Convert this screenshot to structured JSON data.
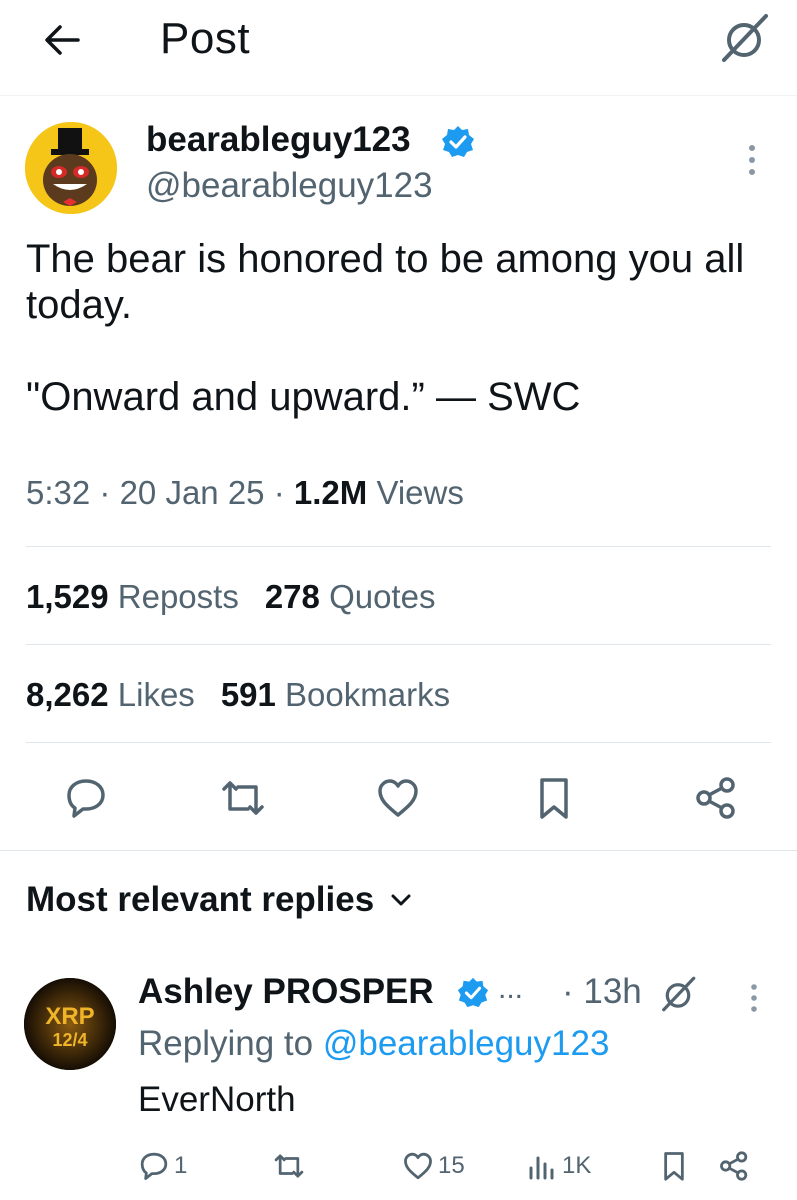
{
  "header": {
    "title": "Post"
  },
  "post": {
    "display_name": "bearableguy123",
    "handle": "@bearableguy123",
    "text": "The bear is honored to be among you all today.\n\n\"Onward and upward.” — SWC",
    "time": "5:32",
    "date": "20 Jan 25",
    "views_count": "1.2M",
    "views_label": "Views",
    "separator": "·"
  },
  "stats": {
    "reposts_count": "1,529",
    "reposts_label": "Reposts",
    "quotes_count": "278",
    "quotes_label": "Quotes",
    "likes_count": "8,262",
    "likes_label": "Likes",
    "bookmarks_count": "591",
    "bookmarks_label": "Bookmarks"
  },
  "replies": {
    "sort_label": "Most relevant replies",
    "items": [
      {
        "display_name": "Ashley PROSPER",
        "ellipsis": "...",
        "time": "· 13h",
        "replying_prefix": "Replying to",
        "replying_to": "@bearableguy123",
        "text": "EverNorth",
        "avatar_text_top": "XRP",
        "avatar_text_bottom": "12/4",
        "reply_count": "1",
        "repost_count": "",
        "like_count": "15",
        "view_count": "1K"
      }
    ]
  },
  "colors": {
    "accent": "#1d9bf0",
    "secondary_text": "#536471",
    "primary_text": "#0f1419",
    "verified": "#1d9bf0",
    "avatar_bg": "#f5c518"
  },
  "icons": [
    "back-arrow-icon",
    "grok-icon",
    "verified-icon",
    "more-vertical-icon",
    "reply-icon",
    "repost-icon",
    "like-icon",
    "bookmark-icon",
    "share-icon",
    "chevron-down-icon",
    "views-icon"
  ]
}
